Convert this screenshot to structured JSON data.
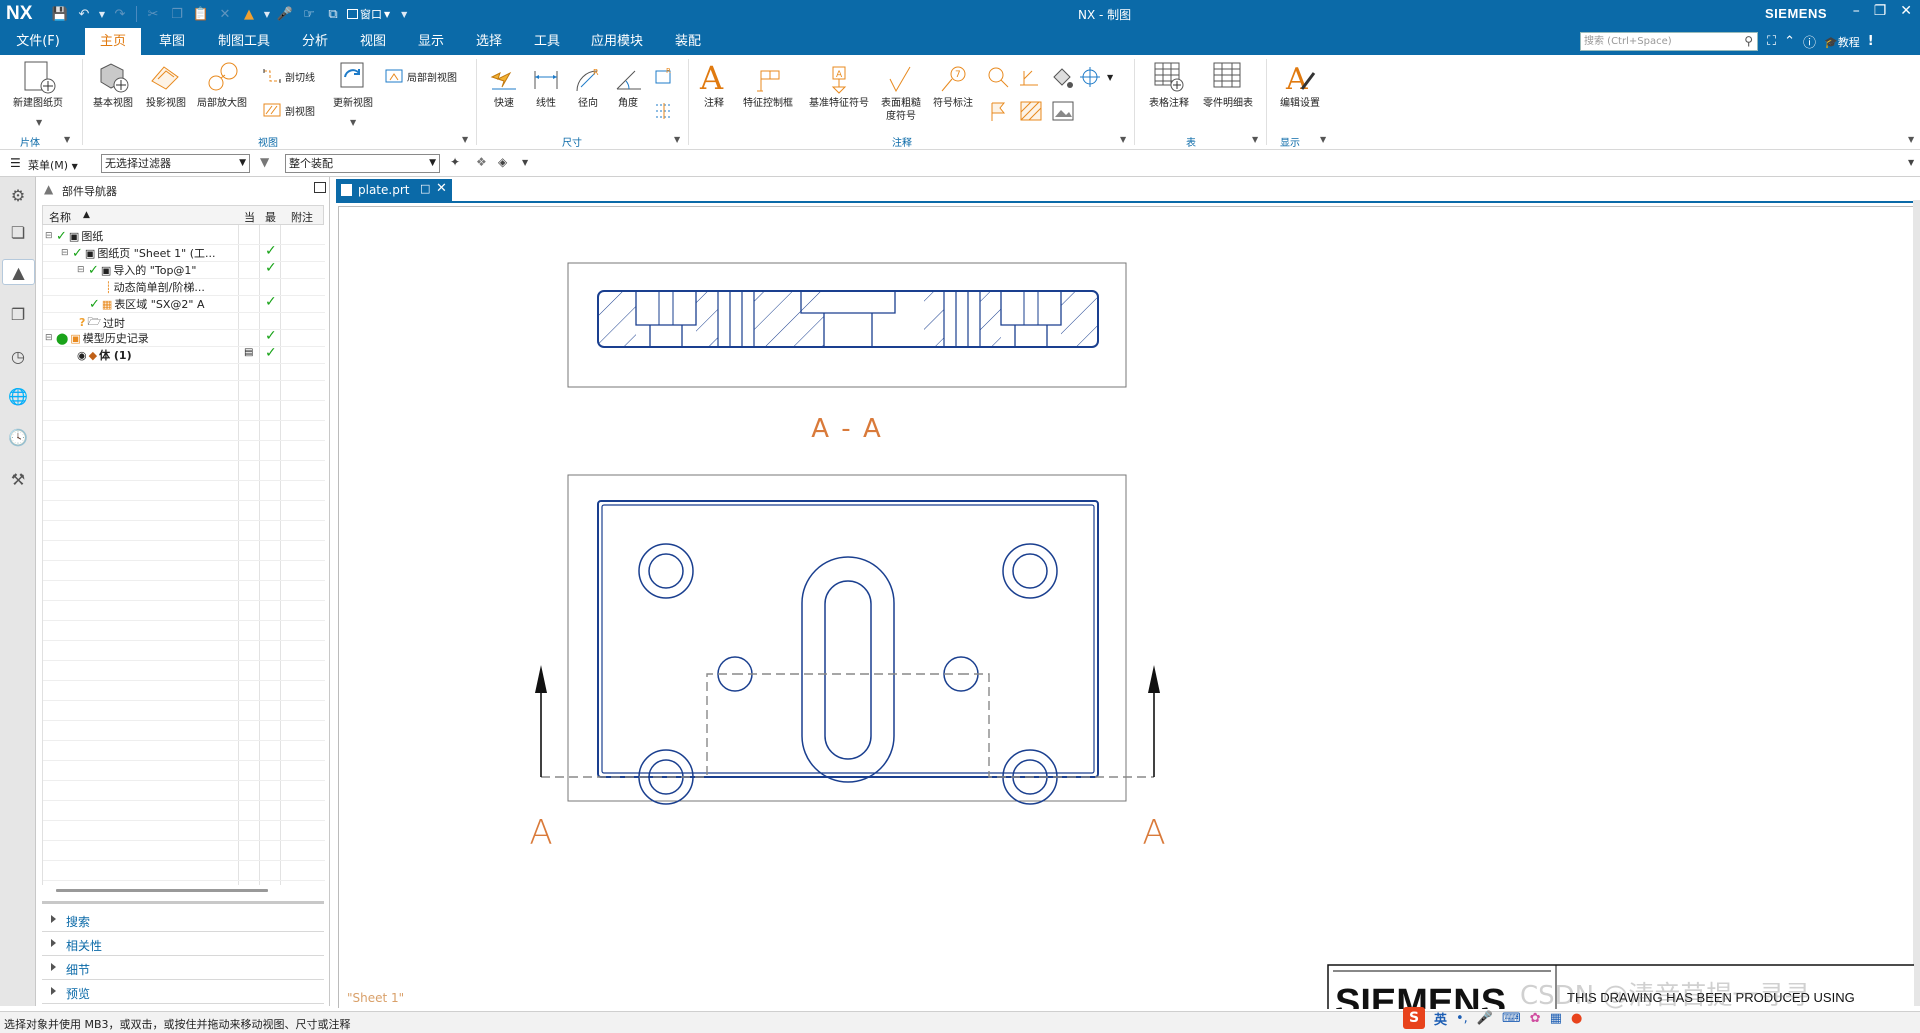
{
  "titlebar": {
    "logo": "NX",
    "window_menu": "窗口",
    "app_title": "NX - 制图",
    "brand": "SIEMENS"
  },
  "menu": {
    "tabs": [
      "文件(F)",
      "主页",
      "草图",
      "制图工具",
      "分析",
      "视图",
      "显示",
      "选择",
      "工具",
      "应用模块",
      "装配"
    ],
    "active_tab": "主页",
    "search_placeholder": "搜索 (Ctrl+Space)",
    "tutorial": "教程"
  },
  "ribbon": {
    "new_sheet": "新建图纸页",
    "base_view": "基本视图",
    "projected_view": "投影视图",
    "detail_view": "局部放大图",
    "section_line": "剖切线",
    "section_view": "剖视图",
    "break_out": "局部剖视图",
    "update_view": "更新视图",
    "rapid": "快速",
    "linear": "线性",
    "radial": "径向",
    "angular": "角度",
    "note": "注释",
    "fcf": "特征控制框",
    "datum": "基准特征符号",
    "surface_line1": "表面粗糙",
    "surface_line2": "度符号",
    "symbol_note": "符号标注",
    "tabular_note": "表格注释",
    "parts_list": "零件明细表",
    "edit_settings": "编辑设置",
    "groups": {
      "sheet": "片体",
      "view": "视图",
      "dimension": "尺寸",
      "annotation": "注释",
      "table": "表",
      "display": "显示"
    }
  },
  "toolbar": {
    "menu_label": "菜单(M)",
    "filter": "无选择过滤器",
    "assembly": "整个装配"
  },
  "navigator": {
    "title": "部件导航器",
    "col_name": "名称",
    "col_current": "当",
    "col_latest": "最",
    "col_attach": "附注",
    "items": [
      {
        "label": "图纸"
      },
      {
        "label": "图纸页 \"Sheet 1\" (工..."
      },
      {
        "label": "导入的 \"Top@1\""
      },
      {
        "label": "动态简单剖/阶梯..."
      },
      {
        "label": "表区域 \"SX@2\" A"
      },
      {
        "label": "过时"
      },
      {
        "label": "模型历史记录"
      },
      {
        "label": "体 (1)"
      }
    ],
    "sections": [
      "搜索",
      "相关性",
      "细节",
      "预览"
    ]
  },
  "document": {
    "tab_name": "plate.prt",
    "section_label": "A - A",
    "arrow_label": "A",
    "sheet_label": "\"Sheet 1\"",
    "title_block_logo": "SIEMENS",
    "title_block_text": "THIS DRAWING HAS BEEN PRODUCED USING"
  },
  "status": {
    "message": "选择对象并使用 MB3，或双击，或按住并拖动来移动视图、尺寸或注释"
  },
  "ime": {
    "lang": "英"
  },
  "watermark": "CSDN @清音苜提一寻寻",
  "colors": {
    "accent": "#0b6aa8",
    "drawing_lines": "#1a3f8f",
    "annotation": "#d97a3a",
    "ok_check": "#18a318"
  }
}
